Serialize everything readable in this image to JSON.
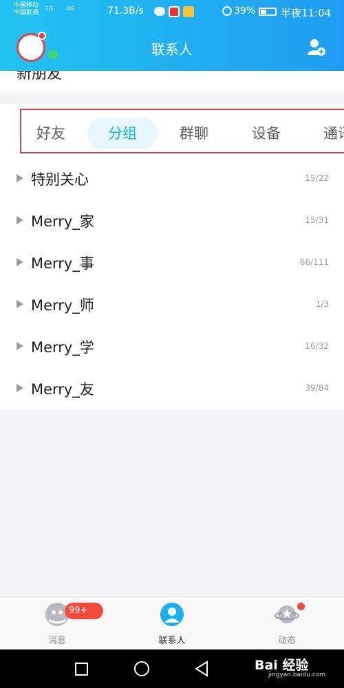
{
  "status_bar": {
    "carrier_1": "中国移动",
    "carrier_2": "中国联通",
    "sig1": "2G",
    "sig2": "4G",
    "speed": "71.3B/s",
    "battery": "39%",
    "time": "半夜11:04"
  },
  "header": {
    "title": "联系人"
  },
  "new_friends_partial": "新朋友",
  "tabs": [
    {
      "label": "好友",
      "active": false
    },
    {
      "label": "分组",
      "active": true
    },
    {
      "label": "群聊",
      "active": false
    },
    {
      "label": "设备",
      "active": false
    },
    {
      "label": "通讯",
      "active": false
    }
  ],
  "groups": [
    {
      "name": "特别关心",
      "count": "15/22"
    },
    {
      "name": "Merry_家",
      "count": "15/31"
    },
    {
      "name": "Merry_事",
      "count": "66/111"
    },
    {
      "name": "Merry_师",
      "count": "1/3"
    },
    {
      "name": "Merry_学",
      "count": "16/32"
    },
    {
      "name": "Merry_友",
      "count": "39/84"
    }
  ],
  "bottom_nav": {
    "messages": "消息",
    "messages_badge": "99+",
    "contacts": "联系人",
    "moments": "动态"
  },
  "watermark": {
    "brand": "Bai 经验",
    "url": "jingyan.baidu.com"
  },
  "colors": {
    "accent": "#13b6ec",
    "highlight_frame": "#d9414a",
    "badge": "#f24a3c"
  }
}
